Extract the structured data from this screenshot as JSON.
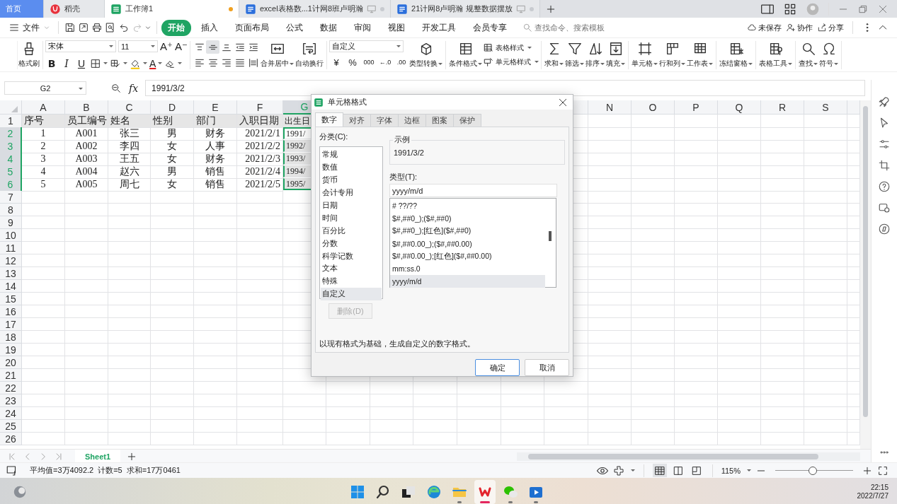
{
  "title_tabs": [
    {
      "label": "首页",
      "kind": "home",
      "selected": false
    },
    {
      "label": "稻壳",
      "kind": "docer",
      "selected": false
    },
    {
      "label": "工作簿1",
      "kind": "sheet",
      "selected": true,
      "modified": true
    },
    {
      "label": "excel表格数...1计网8班卢明瀚",
      "kind": "doc",
      "selected": false,
      "modified": false
    },
    {
      "label": "21计网8卢明瀚 规整数据摆放",
      "kind": "doc",
      "selected": false,
      "modified": false
    }
  ],
  "menu": {
    "file": "文件",
    "quick": [
      {
        "kind": "save",
        "disabled": false
      },
      {
        "kind": "export",
        "disabled": false
      },
      {
        "kind": "print",
        "disabled": false
      },
      {
        "kind": "preview",
        "disabled": false
      },
      {
        "kind": "undo",
        "disabled": false
      },
      {
        "kind": "redo",
        "disabled": true
      }
    ],
    "tabs": [
      {
        "label": "开始",
        "selected": true
      },
      {
        "label": "插入",
        "selected": false
      },
      {
        "label": "页面布局",
        "selected": false
      },
      {
        "label": "公式",
        "selected": false
      },
      {
        "label": "数据",
        "selected": false
      },
      {
        "label": "审阅",
        "selected": false
      },
      {
        "label": "视图",
        "selected": false
      },
      {
        "label": "开发工具",
        "selected": false
      },
      {
        "label": "会员专享",
        "selected": false
      }
    ],
    "search": {
      "placeholder": "查找命令、搜索模板"
    },
    "actions": [
      {
        "label": "未保存",
        "kind": "cloud"
      },
      {
        "label": "协作",
        "kind": "collab"
      },
      {
        "label": "分享",
        "kind": "share"
      }
    ]
  },
  "ribbon": {
    "format_painter": "格式刷",
    "font": {
      "name": "宋体",
      "size": "11",
      "grow": "A⁺",
      "shrink": "A⁻",
      "styles": [
        {
          "label": "B",
          "kind": "bold"
        },
        {
          "label": "I",
          "kind": "italic"
        },
        {
          "label": "U",
          "kind": "underline"
        }
      ],
      "font_color": "A"
    },
    "align": [
      {
        "kind": "a-top",
        "selected": false
      },
      {
        "kind": "a-mid",
        "selected": true
      },
      {
        "kind": "a-bot",
        "selected": false
      },
      {
        "kind": "ind-dec",
        "selected": false
      },
      {
        "kind": "ind-inc",
        "selected": false
      },
      {
        "kind": "a-left",
        "selected": false
      },
      {
        "kind": "a-center",
        "selected": false
      },
      {
        "kind": "a-right",
        "selected": false
      },
      {
        "kind": "justify",
        "selected": false
      },
      {
        "kind": "distribute",
        "selected": false
      }
    ],
    "merge": [
      {
        "label": "合并居中",
        "kind": "merge",
        "dropdown": true
      },
      {
        "label": "自动换行",
        "kind": "wrap",
        "dropdown": false
      }
    ],
    "number": {
      "format": "自定义",
      "buttons": [
        "¥",
        "%",
        "000",
        "←.0",
        ".00"
      ]
    },
    "groups": [
      [
        {
          "label": "类型转换",
          "kind": "cube",
          "dropdown": true
        }
      ],
      [
        {
          "label": "条件格式",
          "kind": "cond",
          "dropdown": true
        },
        {
          "kind": "stack",
          "items": [
            {
              "label": "表格样式",
              "kind": "tablestyle"
            },
            {
              "label": "单元格样式",
              "kind": "cellstyle"
            }
          ]
        }
      ],
      [
        {
          "label": "求和",
          "kind": "sum",
          "dropdown": true
        },
        {
          "label": "筛选",
          "kind": "filter",
          "dropdown": true
        },
        {
          "label": "排序",
          "kind": "sort",
          "dropdown": true
        },
        {
          "label": "填充",
          "kind": "fill",
          "dropdown": true
        }
      ],
      [
        {
          "label": "单元格",
          "kind": "cell",
          "dropdown": true
        },
        {
          "label": "行和列",
          "kind": "rowcol",
          "dropdown": true
        },
        {
          "label": "工作表",
          "kind": "sheet",
          "dropdown": true
        }
      ],
      [
        {
          "label": "冻结窗格",
          "kind": "freeze",
          "dropdown": true
        }
      ],
      [
        {
          "label": "表格工具",
          "kind": "tools",
          "dropdown": true
        }
      ],
      [
        {
          "label": "查找",
          "kind": "find",
          "dropdown": true
        },
        {
          "label": "符号",
          "kind": "symbol",
          "dropdown": true
        }
      ]
    ]
  },
  "formula_bar": {
    "cell": "G2",
    "fx": "fx",
    "value": "1991/3/2"
  },
  "sheet": {
    "columns": [
      {
        "label": "A",
        "selected": false
      },
      {
        "label": "B",
        "selected": false
      },
      {
        "label": "C",
        "selected": false
      },
      {
        "label": "D",
        "selected": false
      },
      {
        "label": "E",
        "selected": false
      },
      {
        "label": "F",
        "selected": false
      },
      {
        "label": "G",
        "selected": true
      },
      {
        "label": "N",
        "selected": false
      },
      {
        "label": "O",
        "selected": false
      },
      {
        "label": "P",
        "selected": false
      },
      {
        "label": "Q",
        "selected": false
      },
      {
        "label": "R",
        "selected": false
      },
      {
        "label": "S",
        "selected": false
      }
    ],
    "rows": [
      {
        "number": "1",
        "selected": false,
        "shaded": true,
        "cells": [
          "序号",
          "员工编号",
          "姓名",
          "性别",
          "部门",
          "入职日期",
          "出生日"
        ]
      },
      {
        "number": "2",
        "selected": true,
        "shaded": false,
        "cells": [
          "1",
          "A001",
          "张三",
          "男",
          "财务",
          "2021/2/1",
          "1991/"
        ]
      },
      {
        "number": "3",
        "selected": true,
        "shaded": false,
        "cells": [
          "2",
          "A002",
          "李四",
          "女",
          "人事",
          "2021/2/2",
          "1992/"
        ]
      },
      {
        "number": "4",
        "selected": true,
        "shaded": false,
        "cells": [
          "3",
          "A003",
          "王五",
          "女",
          "财务",
          "2021/2/3",
          "1993/"
        ]
      },
      {
        "number": "5",
        "selected": true,
        "shaded": false,
        "cells": [
          "4",
          "A004",
          "赵六",
          "男",
          "销售",
          "2021/2/4",
          "1994/"
        ]
      },
      {
        "number": "6",
        "selected": true,
        "shaded": false,
        "cells": [
          "5",
          "A005",
          "周七",
          "女",
          "销售",
          "2021/2/5",
          "1995/"
        ]
      },
      {
        "number": "7",
        "selected": false,
        "shaded": false
      },
      {
        "number": "8",
        "selected": false,
        "shaded": false
      },
      {
        "number": "9",
        "selected": false,
        "shaded": false
      },
      {
        "number": "10",
        "selected": false,
        "shaded": false
      },
      {
        "number": "11",
        "selected": false,
        "shaded": false
      },
      {
        "number": "12",
        "selected": false,
        "shaded": false
      },
      {
        "number": "13",
        "selected": false,
        "shaded": false
      },
      {
        "number": "14",
        "selected": false,
        "shaded": false
      },
      {
        "number": "15",
        "selected": false,
        "shaded": false
      },
      {
        "number": "16",
        "selected": false,
        "shaded": false
      },
      {
        "number": "17",
        "selected": false,
        "shaded": false
      },
      {
        "number": "18",
        "selected": false,
        "shaded": false
      },
      {
        "number": "19",
        "selected": false,
        "shaded": false
      },
      {
        "number": "20",
        "selected": false,
        "shaded": false
      },
      {
        "number": "21",
        "selected": false,
        "shaded": false
      },
      {
        "number": "22",
        "selected": false,
        "shaded": false
      },
      {
        "number": "23",
        "selected": false,
        "shaded": false
      },
      {
        "number": "24",
        "selected": false,
        "shaded": false
      },
      {
        "number": "25",
        "selected": false,
        "shaded": false
      },
      {
        "number": "26",
        "selected": false,
        "shaded": false
      }
    ]
  },
  "sheet_tabs": [
    {
      "label": "Sheet1",
      "selected": true
    }
  ],
  "dialog": {
    "title": "单元格格式",
    "tabs": [
      {
        "label": "数字",
        "selected": true
      },
      {
        "label": "对齐",
        "selected": false
      },
      {
        "label": "字体",
        "selected": false
      },
      {
        "label": "边框",
        "selected": false
      },
      {
        "label": "图案",
        "selected": false
      },
      {
        "label": "保护",
        "selected": false
      }
    ],
    "category_label": "分类(C):",
    "categories": [
      {
        "label": "常规",
        "selected": false
      },
      {
        "label": "数值",
        "selected": false
      },
      {
        "label": "货币",
        "selected": false
      },
      {
        "label": "会计专用",
        "selected": false
      },
      {
        "label": "日期",
        "selected": false
      },
      {
        "label": "时间",
        "selected": false
      },
      {
        "label": "百分比",
        "selected": false
      },
      {
        "label": "分数",
        "selected": false
      },
      {
        "label": "科学记数",
        "selected": false
      },
      {
        "label": "文本",
        "selected": false
      },
      {
        "label": "特殊",
        "selected": false
      },
      {
        "label": "自定义",
        "selected": true
      }
    ],
    "sample_label": "示例",
    "sample": "1991/3/2",
    "type_label": "类型(T):",
    "type_value": "yyyy/m/d",
    "formats": [
      {
        "label": "# ??/??",
        "selected": false
      },
      {
        "label": "$#,##0_);($#,##0)",
        "selected": false
      },
      {
        "label": "$#,##0_);[红色]($#,##0)",
        "selected": false
      },
      {
        "label": "$#,##0.00_);($#,##0.00)",
        "selected": false
      },
      {
        "label": "$#,##0.00_);[红色]($#,##0.00)",
        "selected": false
      },
      {
        "label": "mm:ss.0",
        "selected": false
      },
      {
        "label": "yyyy/m/d",
        "selected": true
      }
    ],
    "delete_button": {
      "label": "删除(D)",
      "disabled": true
    },
    "description": "以现有格式为基础，生成自定义的数字格式。",
    "ok": "确定",
    "cancel": "取消"
  },
  "status_bar": {
    "stats": [
      "平均值=3万4092.2",
      "计数=5",
      "求和=17万0461"
    ],
    "views": [
      {
        "kind": "normal",
        "selected": true
      },
      {
        "kind": "page",
        "selected": false
      },
      {
        "kind": "break",
        "selected": false
      }
    ],
    "zoom": "115%",
    "zoom_slider": {
      "level": 0.48
    }
  },
  "taskbar": {
    "apps": [
      {
        "kind": "start",
        "active": false,
        "running": false
      },
      {
        "kind": "search",
        "active": false,
        "running": false
      },
      {
        "kind": "taskview",
        "active": false,
        "running": false
      },
      {
        "kind": "edge",
        "active": false,
        "running": false
      },
      {
        "kind": "folder",
        "active": false,
        "running": true
      },
      {
        "kind": "wps",
        "active": true,
        "running": true
      },
      {
        "kind": "chat",
        "active": false,
        "running": true
      },
      {
        "kind": "video",
        "active": false,
        "running": true
      }
    ],
    "time": "22:15",
    "date": "2022/7/27"
  }
}
